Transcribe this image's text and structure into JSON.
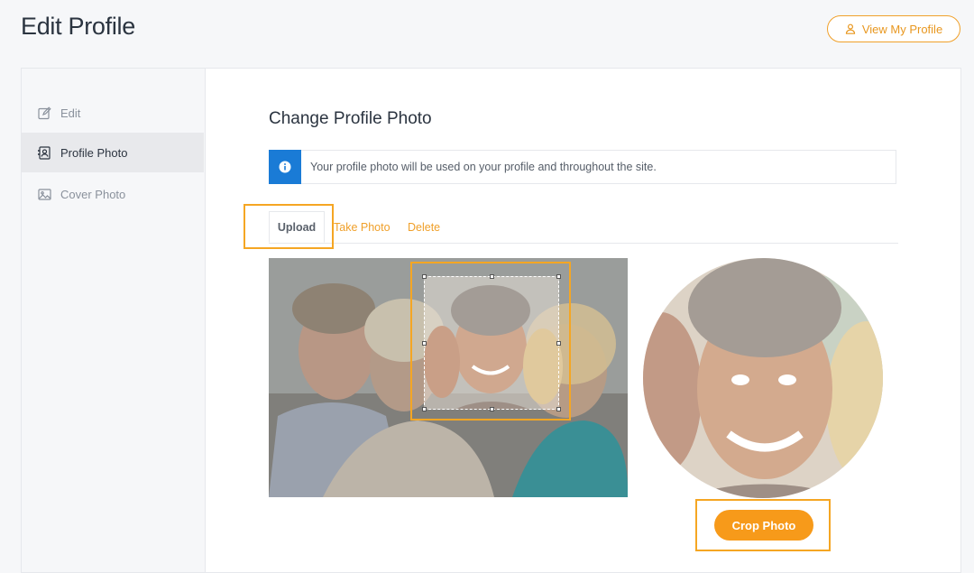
{
  "header": {
    "title": "Edit Profile",
    "view_profile_label": "View My Profile"
  },
  "sidebar": {
    "items": [
      {
        "label": "Edit",
        "icon": "edit-icon"
      },
      {
        "label": "Profile Photo",
        "icon": "profile-photo-icon",
        "active": true
      },
      {
        "label": "Cover Photo",
        "icon": "image-icon"
      }
    ]
  },
  "main": {
    "section_title": "Change Profile Photo",
    "notice": "Your profile photo will be used on your profile and throughout the site.",
    "tabs": [
      {
        "label": "Upload",
        "active": true
      },
      {
        "label": "Take Photo"
      },
      {
        "label": "Delete"
      }
    ],
    "crop_button_label": "Crop Photo"
  },
  "colors": {
    "accent": "#f79a1a",
    "info": "#1a7bd6",
    "highlight": "#f5a623"
  }
}
